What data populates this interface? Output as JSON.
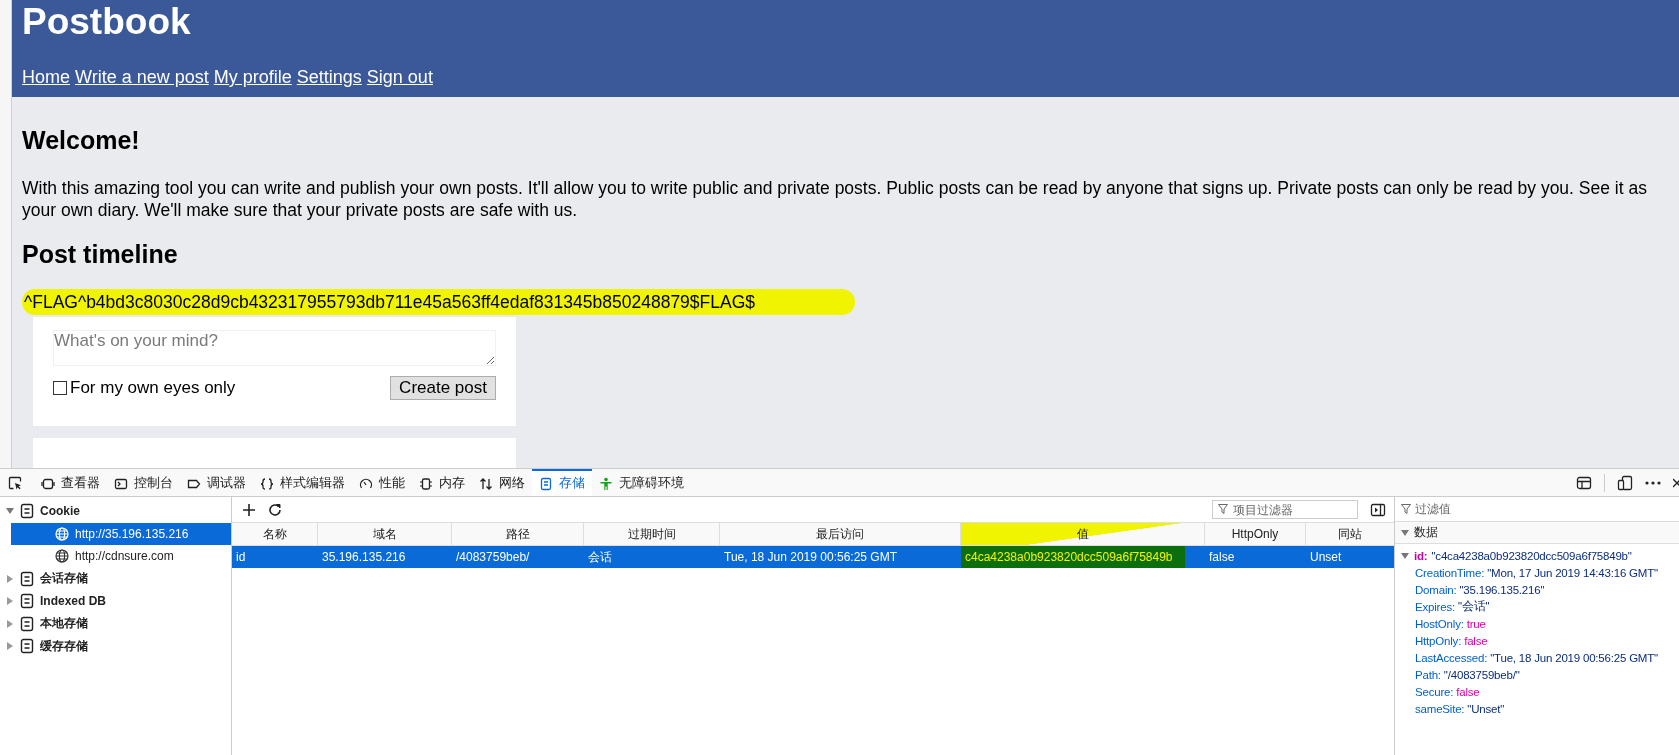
{
  "page": {
    "title": "Postbook",
    "nav": [
      "Home",
      "Write a new post",
      "My profile",
      "Settings",
      "Sign out"
    ],
    "welcome_heading": "Welcome!",
    "welcome_text": "With this amazing tool you can write and publish your own posts. It'll allow you to write public and private posts. Public posts can be read by anyone that signs up. Private posts can only be read by you. See it as your own diary. We'll make sure that your private posts are safe with us.",
    "timeline_heading": "Post timeline",
    "flag": {
      "text": "^FLAG^b4bd3c8030c28d9cb432317955793db711e45a563ff4edaf831345b850248879$FLAG$",
      "highlighted": true
    },
    "composer": {
      "placeholder": "What's on your mind?",
      "private_label": "For my own eyes only",
      "private_checked": false,
      "submit": "Create post"
    }
  },
  "devtools": {
    "tabs": [
      {
        "label": "查看器",
        "selected": false
      },
      {
        "label": "控制台",
        "selected": false
      },
      {
        "label": "调试器",
        "selected": false
      },
      {
        "label": "样式编辑器",
        "selected": false
      },
      {
        "label": "性能",
        "selected": false
      },
      {
        "label": "内存",
        "selected": false
      },
      {
        "label": "网络",
        "selected": false
      },
      {
        "label": "存储",
        "selected": true
      },
      {
        "label": "无障碍环境",
        "selected": false
      }
    ],
    "tree": [
      {
        "label": "Cookie",
        "expanded": true,
        "children": [
          {
            "label": "http://35.196.135.216",
            "selected": true
          },
          {
            "label": "http://cdnsure.com",
            "selected": false
          }
        ]
      },
      {
        "label": "会话存储",
        "expanded": false
      },
      {
        "label": "Indexed DB",
        "expanded": false
      },
      {
        "label": "本地存储",
        "expanded": false
      },
      {
        "label": "缓存存储",
        "expanded": false
      }
    ],
    "filter_placeholder": "项目过滤器",
    "table": {
      "columns": [
        "名称",
        "域名",
        "路径",
        "过期时间",
        "最后访问",
        "值",
        "HttpOnly",
        "同站"
      ],
      "rows": [
        {
          "selected": true,
          "cells": [
            {
              "text": "id"
            },
            {
              "text": "35.196.135.216"
            },
            {
              "text": "/4083759beb/"
            },
            {
              "text": "会话"
            },
            {
              "text": "Tue, 18 Jun 2019 00:56:25 GMT"
            },
            {
              "text": "c4ca4238a0b923820dcc509a6f75849b",
              "highlighted": true
            },
            {
              "text": "false"
            },
            {
              "text": "Unset"
            }
          ]
        }
      ]
    },
    "details": {
      "filter_placeholder": "过滤值",
      "heading": "数据",
      "root": {
        "key": "id:",
        "value": "\"c4ca4238a0b923820dcc509a6f75849b\"",
        "expanded": true
      },
      "entries": [
        {
          "key": "CreationTime:",
          "value": "\"Mon, 17 Jun 2019 14:43:16 GMT\"",
          "kind": "string"
        },
        {
          "key": "Domain:",
          "value": "\"35.196.135.216\"",
          "kind": "string"
        },
        {
          "key": "Expires:",
          "value": "\"会话\"",
          "kind": "string"
        },
        {
          "key": "HostOnly:",
          "value": "true",
          "kind": "boolean"
        },
        {
          "key": "HttpOnly:",
          "value": "false",
          "kind": "boolean"
        },
        {
          "key": "LastAccessed:",
          "value": "\"Tue, 18 Jun 2019 00:56:25 GMT\"",
          "kind": "string"
        },
        {
          "key": "Path:",
          "value": "\"/4083759beb/\"",
          "kind": "string"
        },
        {
          "key": "Secure:",
          "value": "false",
          "kind": "boolean"
        },
        {
          "key": "sameSite:",
          "value": "\"Unset\"",
          "kind": "string"
        }
      ]
    }
  }
}
